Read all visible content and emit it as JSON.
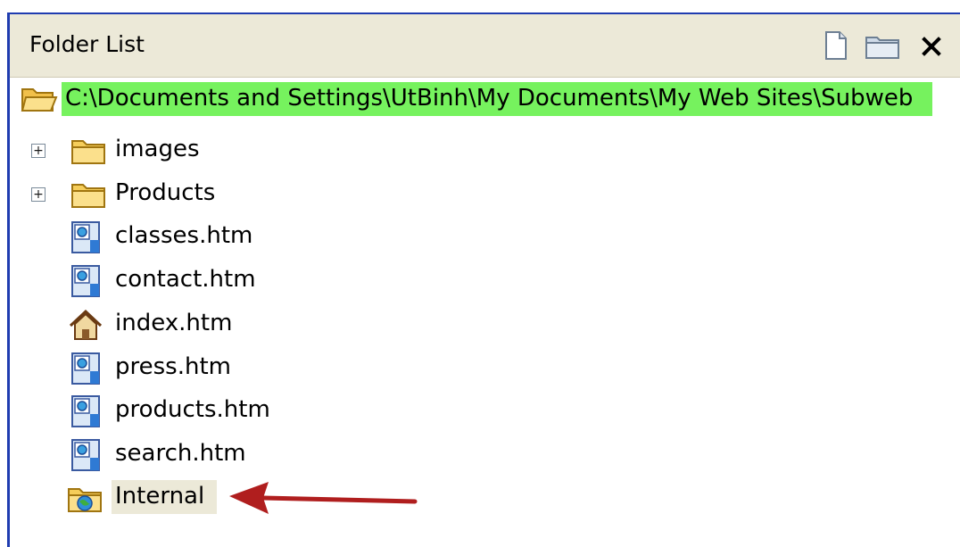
{
  "panel": {
    "title": "Folder List",
    "toolbar": [
      {
        "icon": "new-page-icon"
      },
      {
        "icon": "new-folder-icon"
      },
      {
        "icon": "close-icon"
      }
    ]
  },
  "tree": {
    "root": {
      "label": "C:\\Documents and Settings\\UtBinh\\My Documents\\My Web Sites\\Subweb",
      "highlight": "#76f25e"
    },
    "items": [
      {
        "label": "images",
        "type": "folder",
        "expandable": true,
        "expander": "+"
      },
      {
        "label": "Products",
        "type": "folder",
        "expandable": true,
        "expander": "+"
      },
      {
        "label": "classes.htm",
        "type": "page"
      },
      {
        "label": "contact.htm",
        "type": "page"
      },
      {
        "label": "index.htm",
        "type": "home-page"
      },
      {
        "label": "press.htm",
        "type": "page"
      },
      {
        "label": "products.htm",
        "type": "page"
      },
      {
        "label": "search.htm",
        "type": "page"
      },
      {
        "label": "Internal",
        "type": "subweb",
        "selected": true
      }
    ]
  },
  "annotation": {
    "type": "arrow",
    "color": "#b01e1e",
    "points_to": "Internal"
  }
}
